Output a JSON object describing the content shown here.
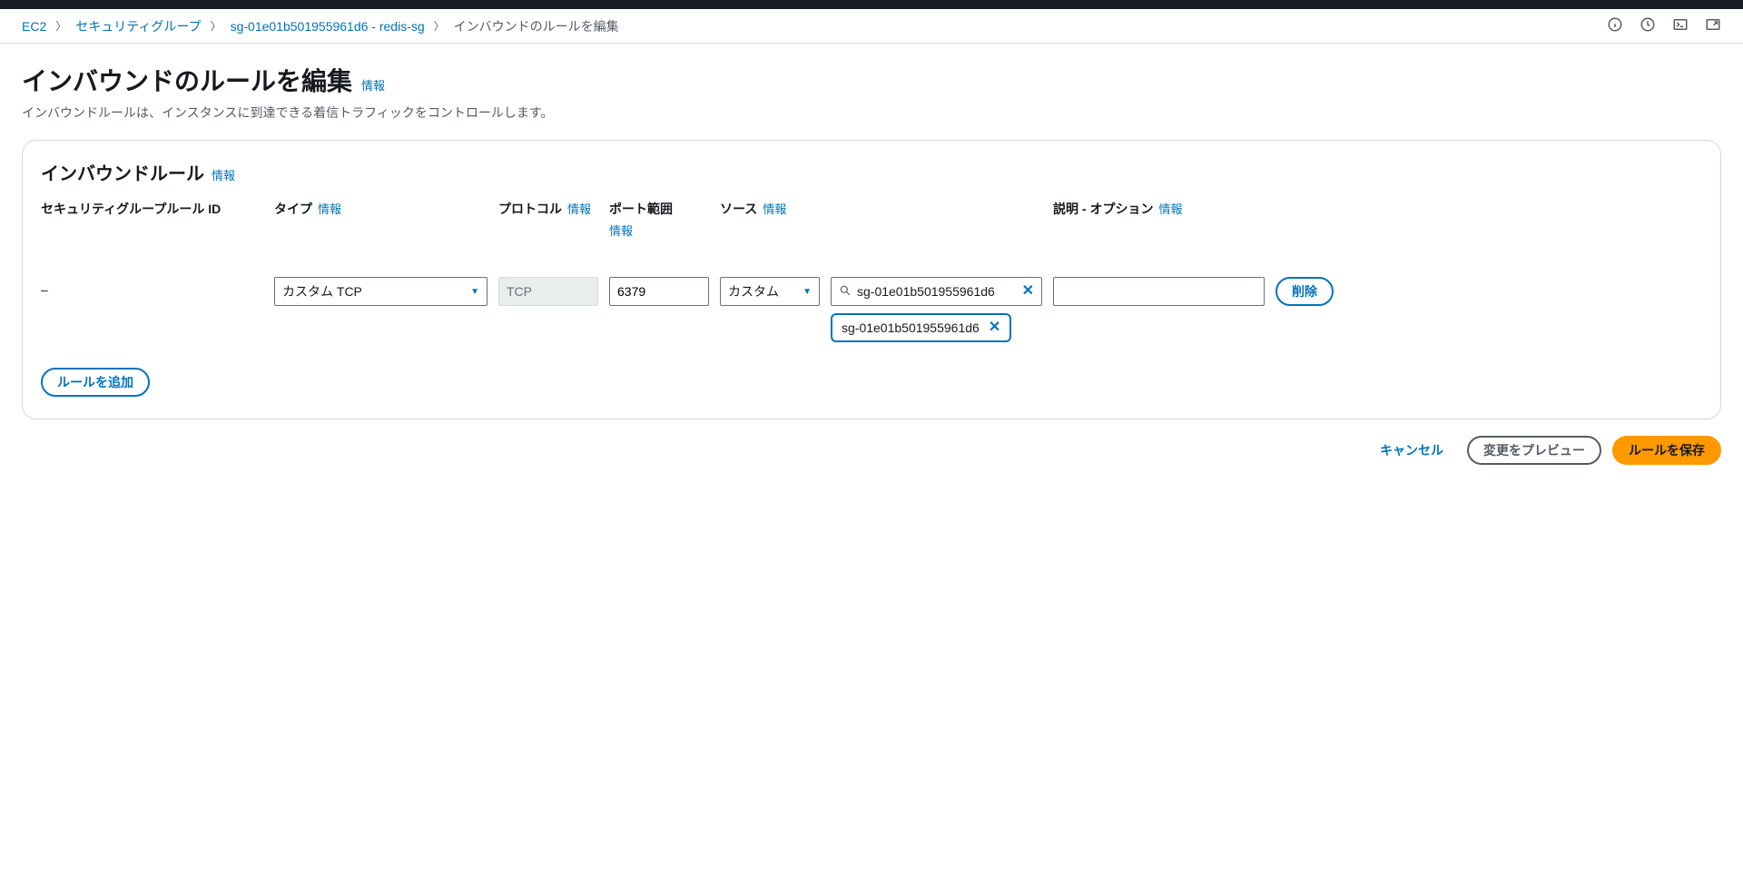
{
  "breadcrumb": {
    "items": [
      {
        "label": "EC2"
      },
      {
        "label": "セキュリティグループ"
      },
      {
        "label": "sg-01e01b501955961d6 - redis-sg"
      }
    ],
    "current": "インバウンドのルールを編集"
  },
  "page": {
    "title": "インバウンドのルールを編集",
    "info": "情報",
    "description": "インバウンドルールは、インスタンスに到達できる着信トラフィックをコントロールします。"
  },
  "panel": {
    "title": "インバウンドルール",
    "info": "情報"
  },
  "columns": {
    "rule_id": "セキュリティグループルール ID",
    "type": "タイプ",
    "protocol": "プロトコル",
    "port_range": "ポート範囲",
    "source": "ソース",
    "description": "説明 - オプション",
    "info": "情報"
  },
  "rule": {
    "id_display": "–",
    "type_value": "カスタム TCP",
    "protocol_value": "TCP",
    "port_value": "6379",
    "source_mode": "カスタム",
    "source_search_value": "sg-01e01b501955961d6",
    "source_token": "sg-01e01b501955961d6",
    "description_value": ""
  },
  "buttons": {
    "delete": "削除",
    "add_rule": "ルールを追加",
    "cancel": "キャンセル",
    "preview": "変更をプレビュー",
    "save": "ルールを保存"
  }
}
